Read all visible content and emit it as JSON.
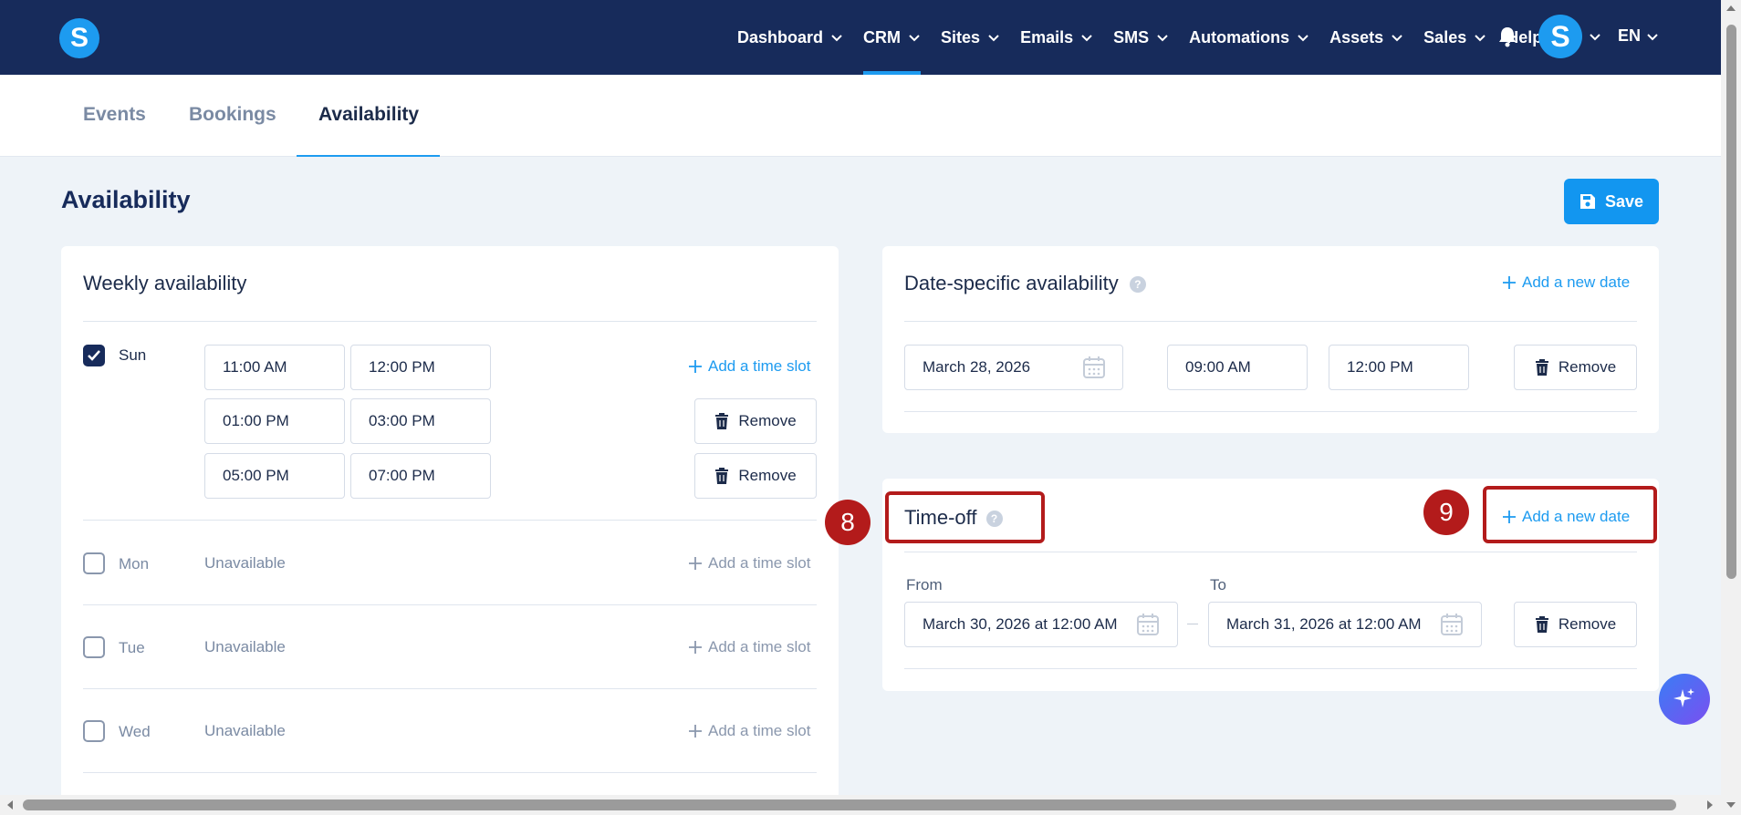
{
  "nav": {
    "logo": "S",
    "items": [
      {
        "label": "Dashboard"
      },
      {
        "label": "CRM"
      },
      {
        "label": "Sites"
      },
      {
        "label": "Emails"
      },
      {
        "label": "SMS"
      },
      {
        "label": "Automations"
      },
      {
        "label": "Assets"
      },
      {
        "label": "Sales"
      },
      {
        "label": "Help"
      }
    ],
    "avatar": "S",
    "lang": "EN"
  },
  "subtabs": [
    {
      "label": "Events"
    },
    {
      "label": "Bookings"
    },
    {
      "label": "Availability"
    }
  ],
  "page": {
    "title": "Availability",
    "save_label": "Save"
  },
  "weekly": {
    "title": "Weekly availability",
    "add_slot_label": "Add a time slot",
    "remove_label": "Remove",
    "unavailable_label": "Unavailable",
    "days": [
      {
        "label": "Sun",
        "slots": [
          {
            "start": "11:00 AM",
            "end": "12:00 PM"
          },
          {
            "start": "01:00 PM",
            "end": "03:00 PM"
          },
          {
            "start": "05:00 PM",
            "end": "07:00 PM"
          }
        ]
      },
      {
        "label": "Mon"
      },
      {
        "label": "Tue"
      },
      {
        "label": "Wed"
      }
    ]
  },
  "date_specific": {
    "title": "Date-specific availability",
    "add_label": "Add a new date",
    "date": "March 28, 2026",
    "start": "09:00 AM",
    "end": "12:00 PM",
    "remove_label": "Remove"
  },
  "time_off": {
    "title": "Time-off",
    "add_label": "Add a new date",
    "from_label": "From",
    "to_label": "To",
    "from_value": "March 30, 2026 at 12:00 AM",
    "to_value": "March 31, 2026 at 12:00 AM",
    "remove_label": "Remove"
  },
  "annotations": [
    "8",
    "9"
  ],
  "colors": {
    "nav_bg": "#172b5b",
    "accent": "#1d9bf0",
    "annotation": "#b31b1b"
  }
}
